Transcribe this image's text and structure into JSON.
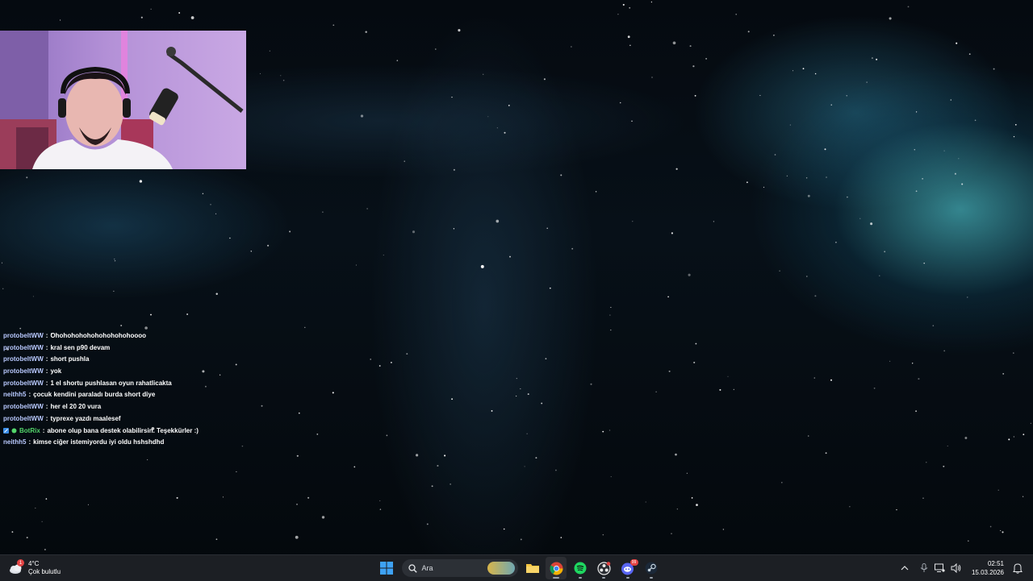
{
  "chat": {
    "messages": [
      {
        "user": "protobeltWW",
        "sep": ":",
        "text": "Ohohohohohohohohohohoooo"
      },
      {
        "user": "protobeltWW",
        "sep": ":",
        "text": "kral sen p90 devam"
      },
      {
        "user": "protobeltWW",
        "sep": ":",
        "text": "short pushla"
      },
      {
        "user": "protobeltWW",
        "sep": ":",
        "text": "yok"
      },
      {
        "user": "protobeltWW",
        "sep": ":",
        "text": "1 el shortu pushlasan oyun rahatlicakta"
      },
      {
        "user": "neithh5",
        "sep": ":",
        "text": "çocuk kendini paraladı burda short diye"
      },
      {
        "user": "protobeltWW",
        "sep": ":",
        "text": "her el 20 20 vura"
      },
      {
        "user": "protobeltWW",
        "sep": ":",
        "text": "typrexe yazdı maalesef"
      },
      {
        "user": "BotRix",
        "sep": ":",
        "text": "abone olup bana destek olabilirsin. Teşekkürler :)",
        "is_bot": true
      },
      {
        "user": "neithh5",
        "sep": ":",
        "text": "kimse ciğer istemiyordu iyi oldu hshshdhd"
      }
    ]
  },
  "taskbar": {
    "weather": {
      "temp": "4°C",
      "condition": "Çok bulutlu",
      "badge": "1",
      "icon": "cloud-icon"
    },
    "search": {
      "placeholder": "Ara",
      "icon": "search-icon"
    },
    "apps": [
      {
        "name": "start-button",
        "icon": "windows-logo-icon"
      },
      {
        "name": "file-explorer",
        "icon": "folder-icon"
      },
      {
        "name": "chrome",
        "icon": "chrome-icon"
      },
      {
        "name": "spotify",
        "icon": "spotify-icon"
      },
      {
        "name": "obs",
        "icon": "obs-icon"
      },
      {
        "name": "discord",
        "icon": "discord-icon",
        "badge": "99"
      },
      {
        "name": "steam",
        "icon": "steam-icon"
      }
    ],
    "clock": {
      "time": "02:51",
      "date": "15.03.2026"
    },
    "accent": "#3b8ee8"
  }
}
